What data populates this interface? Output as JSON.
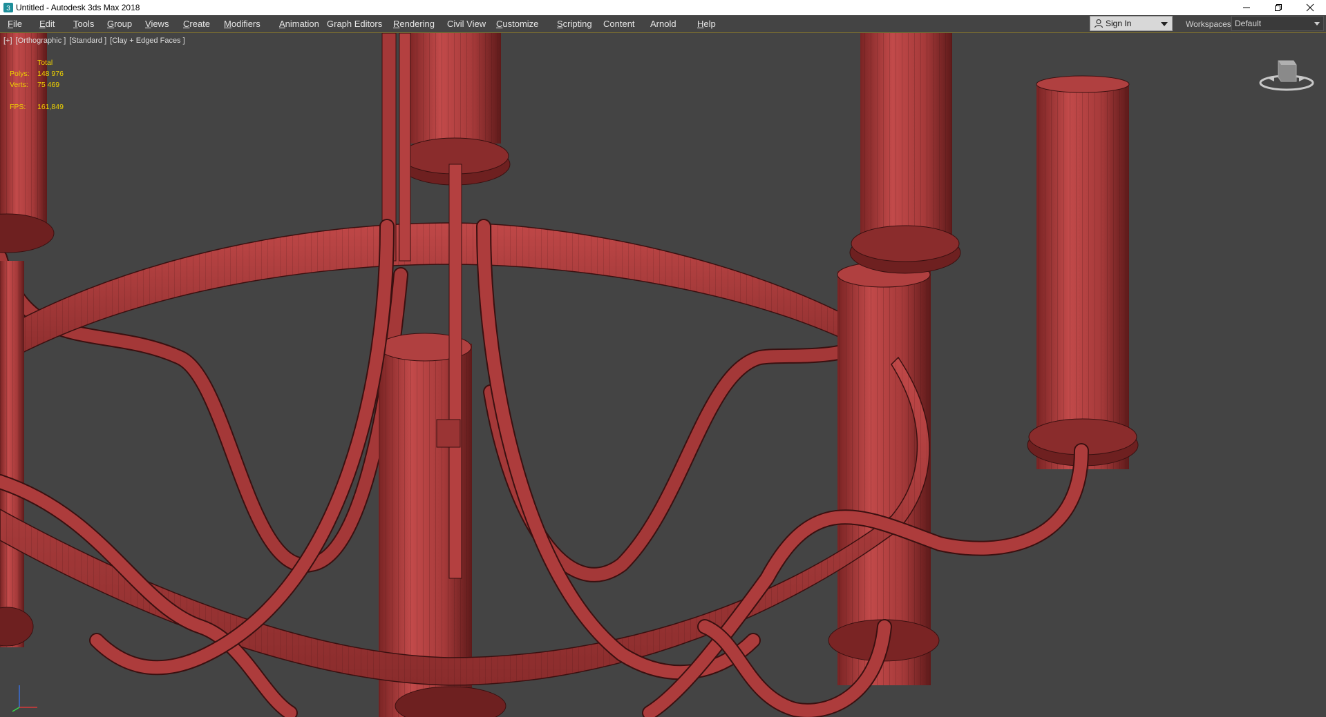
{
  "window": {
    "title": "Untitled - Autodesk 3ds Max 2018",
    "icon": "3ds-max-app-icon",
    "controls": [
      "minimize-icon",
      "restore-icon",
      "close-icon"
    ]
  },
  "menubar": {
    "items": [
      {
        "label": "File",
        "u": "F",
        "rest": "ile"
      },
      {
        "label": "Edit",
        "u": "E",
        "rest": "dit"
      },
      {
        "label": "Tools",
        "u": "T",
        "rest": "ools"
      },
      {
        "label": "Group",
        "u": "G",
        "rest": "roup"
      },
      {
        "label": "Views",
        "u": "V",
        "rest": "iews"
      },
      {
        "label": "Create",
        "u": "C",
        "rest": "reate"
      },
      {
        "label": "Modifiers",
        "u": "M",
        "rest": "odifiers"
      },
      {
        "label": "Animation",
        "u": "A",
        "rest": "nimation"
      },
      {
        "label": "Graph Editors",
        "u": "",
        "rest": "Graph Editors"
      },
      {
        "label": "Rendering",
        "u": "R",
        "rest": "endering"
      },
      {
        "label": "Civil View",
        "u": "",
        "rest": "Civil View"
      },
      {
        "label": "Customize",
        "u": "C",
        "rest": "ustomize"
      },
      {
        "label": "Scripting",
        "u": "S",
        "rest": "cripting"
      },
      {
        "label": "Content",
        "u": "",
        "rest": "Content"
      },
      {
        "label": "Arnold",
        "u": "",
        "rest": "Arnold"
      },
      {
        "label": "Help",
        "u": "H",
        "rest": "elp"
      }
    ],
    "signin_label": "Sign In",
    "workspaces_label": "Workspaces:",
    "workspace_value": "Default"
  },
  "viewport": {
    "label_parts": [
      "[+]",
      "[Orthographic ]",
      "[Standard ]",
      "[Clay + Edged Faces ]"
    ],
    "stats": {
      "total_label": "Total",
      "polys_label": "Polys:",
      "polys_value": "148 976",
      "verts_label": "Verts:",
      "verts_value": "75 469",
      "fps_label": "FPS:",
      "fps_value": "161,849"
    },
    "viewcube": "viewcube-icon",
    "tripod": "axis-tripod-icon"
  },
  "colors": {
    "background": "#444444",
    "menu_text": "#e6e6e6",
    "stats_text": "#f0d300",
    "model_fill": "#b84444",
    "model_shade": "#6e2020",
    "model_edge": "#3a1010"
  }
}
